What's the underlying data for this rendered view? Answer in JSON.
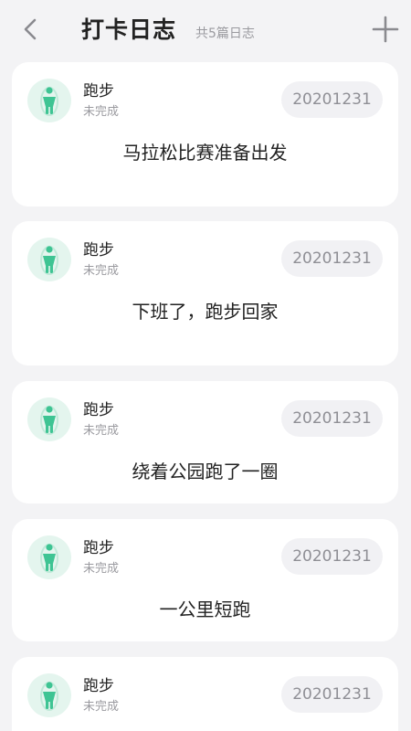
{
  "header": {
    "title": "打卡日志",
    "subtitle": "共5篇日志"
  },
  "colors": {
    "accent": "#3ec493",
    "avatar_bg": "#e4f5ee",
    "background": "#f3f3f5",
    "badge_bg": "#f1f1f4"
  },
  "icons": {
    "back": "chevron-left-icon",
    "add": "plus-icon",
    "avatar": "jump-rope-person-icon"
  },
  "logs": [
    {
      "title": "跑步",
      "status": "未完成",
      "date": "20201231",
      "content": "马拉松比赛准备出发"
    },
    {
      "title": "跑步",
      "status": "未完成",
      "date": "20201231",
      "content": "下班了，跑步回家"
    },
    {
      "title": "跑步",
      "status": "未完成",
      "date": "20201231",
      "content": "绕着公园跑了一圈"
    },
    {
      "title": "跑步",
      "status": "未完成",
      "date": "20201231",
      "content": "一公里短跑"
    },
    {
      "title": "跑步",
      "status": "未完成",
      "date": "20201231",
      "content": ""
    }
  ]
}
